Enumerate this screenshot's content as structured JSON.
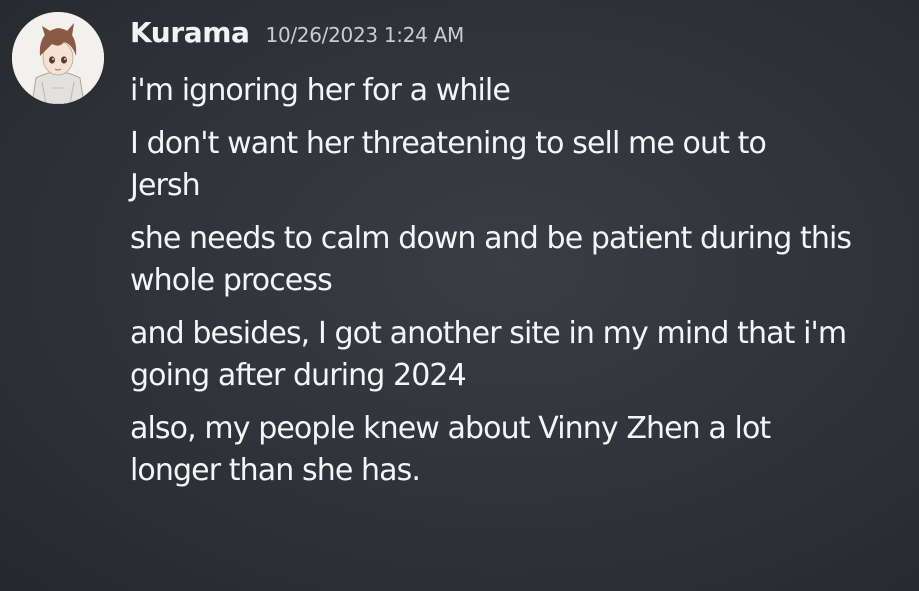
{
  "message": {
    "avatar_icon": "anime-character-avatar-icon",
    "username": "Kurama",
    "timestamp": "10/26/2023 1:24 AM",
    "lines": [
      "i'm ignoring her for a while",
      "I don't want her threatening to sell me out to Jersh",
      "she needs to calm down and be patient during this whole process",
      "and besides, I got another site in my mind that i'm going after during 2024",
      "also, my people knew about Vinny Zhen a lot longer than she has."
    ]
  },
  "colors": {
    "background": "#2f3238",
    "username": "#f2f3f5",
    "timestamp": "#c9ccd2",
    "text": "#f4f5f7"
  }
}
